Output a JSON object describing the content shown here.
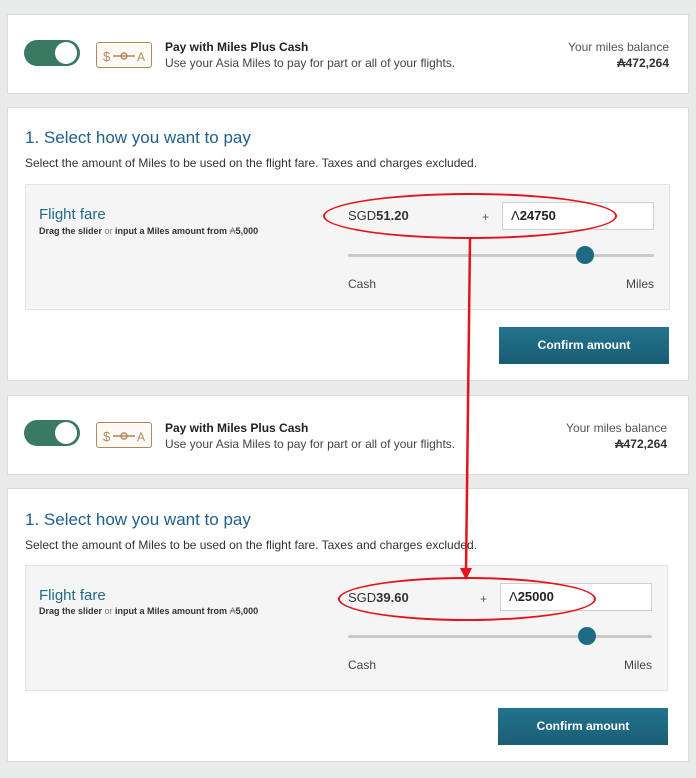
{
  "panels": [
    {
      "pay_with": {
        "title": "Pay with Miles Plus Cash",
        "desc": "Use your Asia Miles to pay for part or all of your flights.",
        "balance_label": "Your miles balance",
        "balance_value": "472,264",
        "toggle_on": true
      },
      "select": {
        "title": "1. Select how you want to pay",
        "desc": "Select the amount of Miles to be used on the flight fare. Taxes and charges excluded.",
        "fare_title": "Flight fare",
        "hint_drag": "Drag the slider",
        "hint_or": " or ",
        "hint_input": "input a Miles amount from ",
        "hint_min": "5,000",
        "currency": "SGD",
        "cash_amount": "51.20",
        "plus": "+",
        "miles_value": "24750",
        "cash_label": "Cash",
        "miles_label": "Miles",
        "confirm": "Confirm amount",
        "slider_fraction": 0.83
      }
    },
    {
      "pay_with": {
        "title": "Pay with Miles Plus Cash",
        "desc": "Use your Asia Miles to pay for part or all of your flights.",
        "balance_label": "Your miles balance",
        "balance_value": "472,264",
        "toggle_on": true
      },
      "select": {
        "title": "1. Select how you want to pay",
        "desc": "Select the amount of Miles to be used on the flight fare. Taxes and charges excluded.",
        "fare_title": "Flight fare",
        "hint_drag": "Drag the slider",
        "hint_or": " or ",
        "hint_input": "input a Miles amount from ",
        "hint_min": "5,000",
        "currency": "SGD",
        "cash_amount": "39.60",
        "plus": "+",
        "miles_value": "25000",
        "cash_label": "Cash",
        "miles_label": "Miles",
        "confirm": "Confirm amount",
        "slider_fraction": 0.78
      }
    }
  ],
  "colors": {
    "toggle": "#3a7a63",
    "accent": "#1f6b85",
    "annotation": "#e3141b"
  },
  "icons": [
    "cash-miles-icon",
    "asia-miles-icon"
  ]
}
